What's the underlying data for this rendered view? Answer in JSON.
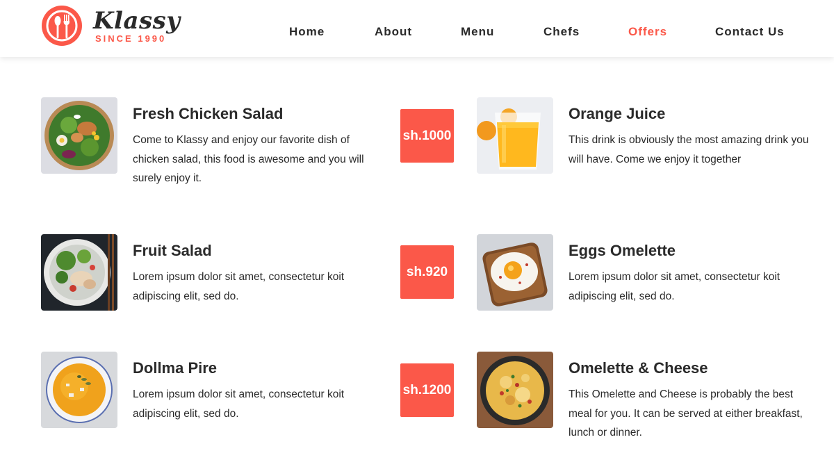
{
  "brand": {
    "name": "Klassy",
    "tagline": "SINCE 1990",
    "accent_color": "#fb5849",
    "logo_icon": "spoon-fork-plate-icon"
  },
  "nav": {
    "items": [
      {
        "label": "Home",
        "active": false
      },
      {
        "label": "About",
        "active": false
      },
      {
        "label": "Menu",
        "active": false
      },
      {
        "label": "Chefs",
        "active": false
      },
      {
        "label": "Offers",
        "active": true
      },
      {
        "label": "Contact Us",
        "active": false
      }
    ]
  },
  "menu": {
    "left": [
      {
        "title": "Fresh Chicken Salad",
        "description": "Come to Klassy and enjoy our favorite dish of chicken salad, this food is awesome and you will surely enjoy it.",
        "price": "sh.1000",
        "image": "chicken-salad-bowl"
      },
      {
        "title": "Fruit Salad",
        "description": "Lorem ipsum dolor sit amet, consectetur koit adipiscing elit, sed do.",
        "price": "sh.920",
        "image": "fruit-salad-bowl"
      },
      {
        "title": "Dollma Pire",
        "description": "Lorem ipsum dolor sit amet, consectetur koit adipiscing elit, sed do.",
        "price": "sh.1200",
        "image": "soup-bowl"
      }
    ],
    "right": [
      {
        "title": "Orange Juice",
        "description": "This drink is obviously the most amazing drink you will have. Come we enjoy it together",
        "image": "orange-juice-glass"
      },
      {
        "title": "Eggs Omelette",
        "description": "Lorem ipsum dolor sit amet, consectetur koit adipiscing elit, sed do.",
        "image": "fried-egg-toast"
      },
      {
        "title": "Omelette & Cheese",
        "description": "This Omelette and Cheese is probably the best meal for you. It can be served at either breakfast, lunch or dinner.",
        "image": "omelette-cheese-pan"
      }
    ]
  }
}
